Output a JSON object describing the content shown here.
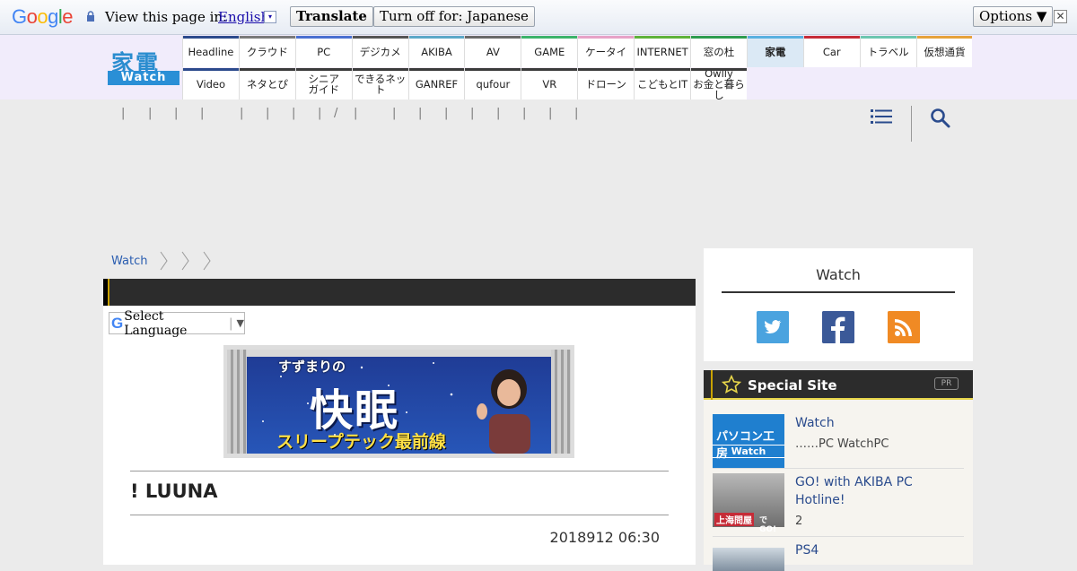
{
  "translate_bar": {
    "logo_letters": [
      "G",
      "o",
      "o",
      "g",
      "l",
      "e"
    ],
    "view_text": "View this page in:",
    "language": "English",
    "dropdown_glyph": "▾",
    "translate_button": "Translate",
    "turn_off_button": "Turn off for: Japanese",
    "options_button": "Options ▼",
    "close_glyph": "✕"
  },
  "header": {
    "logo_kanji": "家電",
    "logo_watch": "Watch",
    "nav_row1": [
      {
        "label": "Headline",
        "color": "#2c4a8c"
      },
      {
        "label": "クラウド",
        "color": "#7a7a7a"
      },
      {
        "label": "PC",
        "color": "#4a6fd1"
      },
      {
        "label": "デジカメ",
        "color": "#555555"
      },
      {
        "label": "AKIBA",
        "color": "#5ca8c8"
      },
      {
        "label": "AV",
        "color": "#6a6a6a"
      },
      {
        "label": "GAME",
        "color": "#3db36b"
      },
      {
        "label": "ケータイ",
        "color": "#e7a2c7"
      },
      {
        "label": "INTERNET",
        "color": "#5fb23a"
      },
      {
        "label": "窓の杜",
        "color": "#2e9c4f"
      },
      {
        "label": "家電",
        "color": "#5ab0e0",
        "active": true
      },
      {
        "label": "Car",
        "color": "#c62b37"
      },
      {
        "label": "トラベル",
        "color": "#6cc6b0"
      },
      {
        "label": "仮想通貨",
        "color": "#e6a23c"
      }
    ],
    "nav_row2": [
      {
        "label": "Video"
      },
      {
        "label": "ネタとぴ"
      },
      {
        "label": "シニア\nガイド"
      },
      {
        "label": "できるネット"
      },
      {
        "label": "GANREF"
      },
      {
        "label": "qufour"
      },
      {
        "label": "VR"
      },
      {
        "label": "ドローン"
      },
      {
        "label": "こどもとIT"
      },
      {
        "label": "Owlly\nお金と暮らし"
      }
    ]
  },
  "subbar": {
    "pipes": [
      "|",
      "|",
      "|",
      "|",
      "|",
      "|",
      "|",
      "|",
      "/",
      "|",
      "|",
      "|",
      "|",
      "|",
      "|",
      "|",
      "|",
      "|"
    ]
  },
  "breadcrumb": {
    "items": [
      "Watch"
    ]
  },
  "main": {
    "select_language": "Select Language",
    "banner": {
      "sub": "すずまりの",
      "main": "快眠",
      "tag": "スリープテック最前線"
    },
    "title": "! LUUNA",
    "date": "2018912 06:30"
  },
  "sidebar": {
    "watch_title": "Watch",
    "social": [
      "twitter-icon",
      "facebook-icon",
      "rss-icon"
    ],
    "special_title": "Special Site",
    "pr_label": "PR",
    "items": [
      {
        "thumb_text": "パソコン工房",
        "thumb_sub": "Watch",
        "title": " Watch",
        "desc": "……PC WatchPC"
      },
      {
        "thumb_text": "上海問屋",
        "thumb_sub": "で GO!",
        "title": "GO! with AKIBA PC Hotline!",
        "desc": "2"
      },
      {
        "thumb_text": "",
        "thumb_sub": "",
        "title": "PS4",
        "desc": ""
      }
    ]
  }
}
